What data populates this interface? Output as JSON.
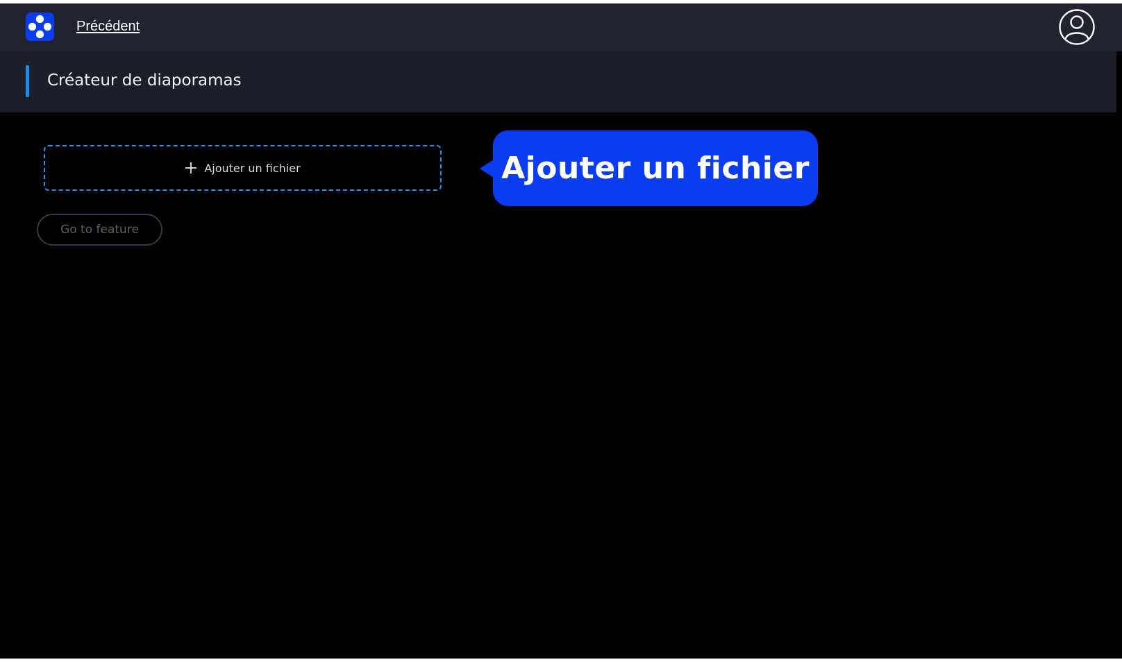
{
  "topbar": {
    "logo_icon": "flower-logo-icon",
    "back_label": "Précédent",
    "avatar_icon": "user-avatar-icon"
  },
  "header": {
    "title": "Créateur de diaporamas"
  },
  "main": {
    "dropzone": {
      "icon": "plus-icon",
      "label": "Ajouter un fichier"
    },
    "feature_button_label": "Go to feature"
  },
  "tooltip": {
    "text": "Ajouter un fichier"
  },
  "colors": {
    "brand": "#0c3cf0",
    "accent": "#1b8cf0",
    "dropzone_border": "#2c8ee6",
    "topbar": "#21242f",
    "subheader": "#1c1e28",
    "background": "#000000"
  }
}
